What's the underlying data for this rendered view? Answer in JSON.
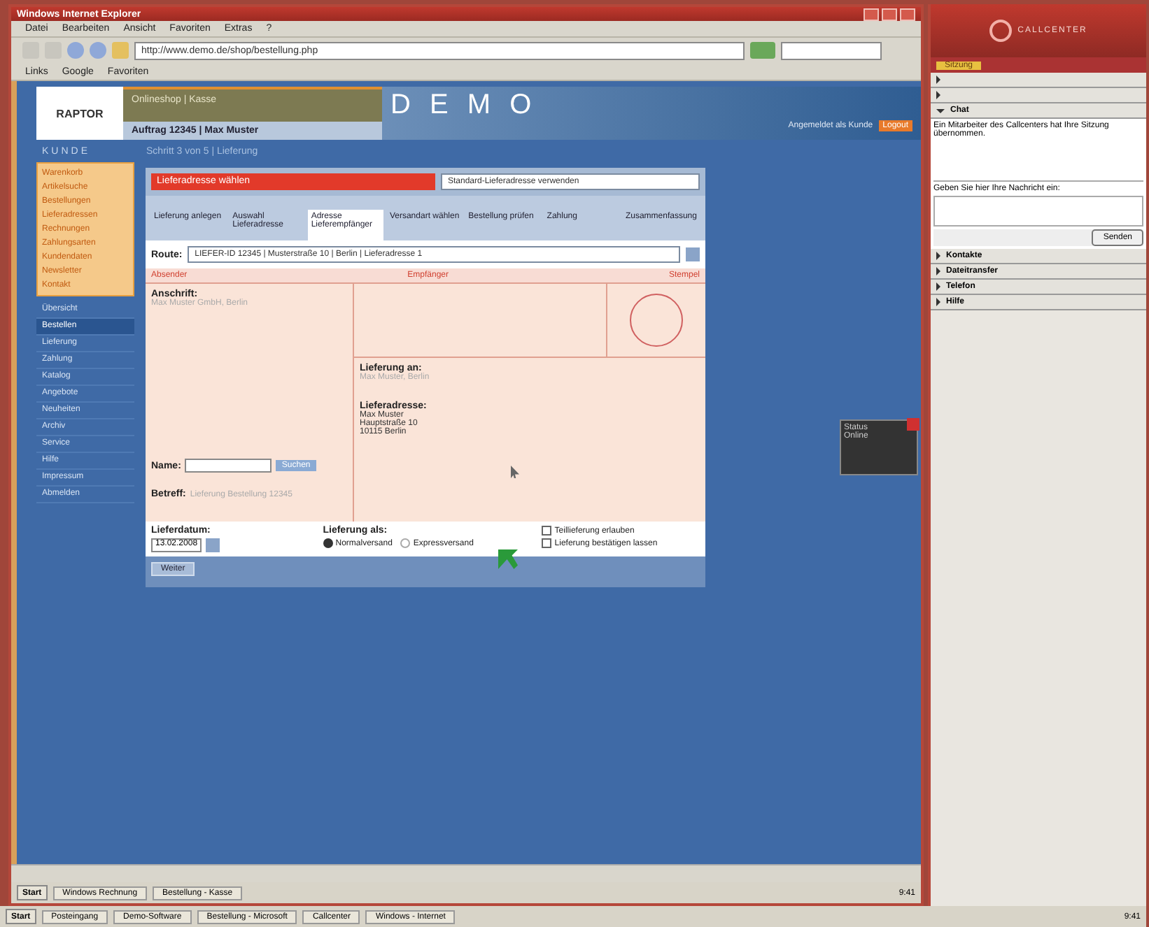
{
  "browser": {
    "title": "Windows Internet Explorer",
    "menu": [
      "Datei",
      "Bearbeiten",
      "Ansicht",
      "Favoriten",
      "Extras",
      "?"
    ],
    "address": "http://www.demo.de/shop/bestellung.php",
    "links": [
      "Links",
      "Google",
      "Favoriten"
    ]
  },
  "site": {
    "logo": "RAPTOR",
    "header_title": "Onlineshop | Kasse",
    "order_line": "Auftrag 12345 | Max Muster",
    "banner": "D E M O",
    "login_info": "Angemeldet als Kunde",
    "logout": "Logout",
    "nav_label": "KUNDE",
    "breadcrumb": "Schritt 3 von 5 | Lieferung"
  },
  "sidebar": {
    "orange_items": [
      "Warenkorb",
      "Artikelsuche",
      "Bestellungen",
      "Lieferadressen",
      "Rechnungen",
      "Zahlungsarten",
      "Kundendaten",
      "Newsletter",
      "Kontakt"
    ],
    "blue_items": [
      {
        "label": "Übersicht",
        "selected": false
      },
      {
        "label": "Bestellen",
        "selected": true
      },
      {
        "label": "Lieferung",
        "selected": false
      },
      {
        "label": "Zahlung",
        "selected": false
      },
      {
        "label": "Katalog",
        "selected": false
      },
      {
        "label": "Angebote",
        "selected": false
      },
      {
        "label": "Neuheiten",
        "selected": false
      },
      {
        "label": "Archiv",
        "selected": false
      },
      {
        "label": "Service",
        "selected": false
      },
      {
        "label": "Hilfe",
        "selected": false
      },
      {
        "label": "Impressum",
        "selected": false
      },
      {
        "label": "Abmelden",
        "selected": false
      }
    ]
  },
  "form": {
    "alert": "Lieferadresse wählen",
    "address_select": "Standard-Lieferadresse verwenden",
    "tabs": [
      {
        "label": "Lieferung anlegen",
        "selected": false
      },
      {
        "label": "Auswahl Lieferadresse",
        "selected": false
      },
      {
        "label": "Adresse Lieferempfänger",
        "selected": true
      },
      {
        "label": "Versandart wählen",
        "selected": false
      },
      {
        "label": "Bestellung prüfen",
        "selected": false
      },
      {
        "label": "Zahlung",
        "selected": false
      },
      {
        "label": "Zusammenfassung",
        "selected": false
      }
    ],
    "route_label": "Route:",
    "route_value": "LIEFER-ID 12345 | Musterstraße 10 | Berlin | Lieferadresse 1",
    "column_heads": [
      "Absender",
      "Empfänger",
      "Stempel"
    ],
    "sender_label": "Anschrift:",
    "sender_hint": "Max Muster GmbH, Berlin",
    "name_label": "Name:",
    "search_button": "Suchen",
    "subject_label": "Betreff:",
    "subject_hint": "Lieferung Bestellung 12345",
    "deliver_to_label": "Lieferung an:",
    "deliver_to_hint": "Max Muster, Berlin",
    "address_label": "Lieferadresse:",
    "address_lines": [
      "Max Muster",
      "Hauptstraße 10",
      "10115 Berlin"
    ],
    "date_label": "Lieferdatum:",
    "date_value": "13.02.2008",
    "mode_label": "Lieferung als:",
    "modes": [
      {
        "label": "Normalversand",
        "selected": true
      },
      {
        "label": "Expressversand",
        "selected": false
      }
    ],
    "options": [
      {
        "label": "Teillieferung erlauben",
        "checked": false
      },
      {
        "label": "Lieferung bestätigen lassen",
        "checked": false
      }
    ],
    "submit": "Weiter"
  },
  "popup": [
    "Status",
    "Online"
  ],
  "panel": {
    "brand": "CALLCENTER",
    "tab": "Sitzung",
    "sections": [
      {
        "expanded": false
      },
      {
        "expanded": false
      },
      {
        "title": "Chat",
        "expanded": true
      },
      {
        "title": "Kontakte",
        "expanded": false
      },
      {
        "title": "Dateitransfer",
        "expanded": false
      },
      {
        "title": "Telefon",
        "expanded": false
      },
      {
        "title": "Hilfe",
        "expanded": false
      }
    ],
    "chat_message": "Ein Mitarbeiter des Callcenters hat Ihre Sitzung übernommen.",
    "chat_prompt": "Geben Sie hier Ihre Nachricht ein:",
    "send": "Senden"
  },
  "inner_taskbar": {
    "start": "Start",
    "items": [
      "Windows Rechnung",
      "Bestellung - Kasse"
    ],
    "clock": "9:41"
  },
  "taskbar": {
    "start": "Start",
    "items": [
      "Posteingang",
      "Demo-Software",
      "Bestellung - Microsoft",
      "Callcenter",
      "Windows - Internet"
    ],
    "clock": "9:41"
  }
}
